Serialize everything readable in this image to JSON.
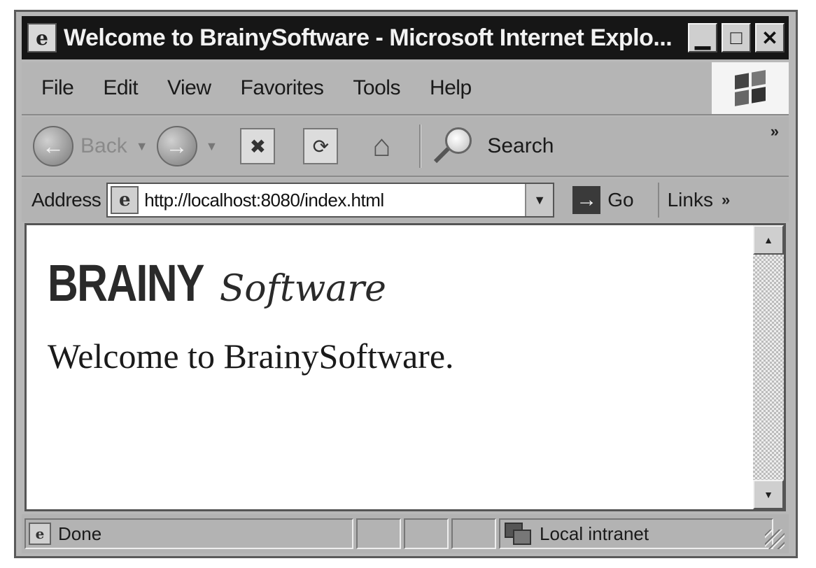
{
  "window": {
    "title": "Welcome to BrainySoftware - Microsoft Internet Explo...",
    "title_icon": "ie-page-icon",
    "controls": {
      "minimize_glyph": "▁",
      "maximize_glyph": "□",
      "close_glyph": "✕"
    }
  },
  "menubar": {
    "items": [
      "File",
      "Edit",
      "View",
      "Favorites",
      "Tools",
      "Help"
    ]
  },
  "toolbar": {
    "back_label": "Back",
    "search_label": "Search",
    "overflow_glyph": "»"
  },
  "address": {
    "label": "Address",
    "url": "http://localhost:8080/index.html",
    "go_label": "Go",
    "links_label": "Links",
    "links_chevron": "»"
  },
  "content": {
    "logo_brainy": "BRAINY",
    "logo_software": "Software",
    "welcome_text": "Welcome to BrainySoftware."
  },
  "statusbar": {
    "status_text": "Done",
    "zone_text": "Local intranet"
  }
}
